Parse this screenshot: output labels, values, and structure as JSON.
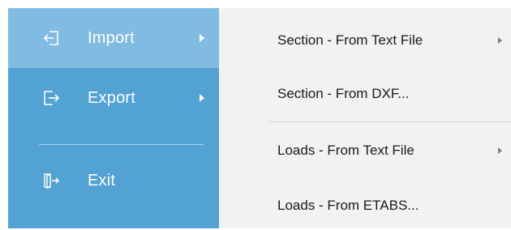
{
  "main_menu": {
    "items": [
      {
        "label": "Import",
        "icon": "import-icon",
        "has_submenu": true,
        "active": true
      },
      {
        "label": "Export",
        "icon": "export-icon",
        "has_submenu": true,
        "active": false
      },
      {
        "label": "Exit",
        "icon": "exit-icon",
        "has_submenu": false,
        "active": false
      }
    ]
  },
  "import_submenu": {
    "items": [
      {
        "label": "Section - From Text File",
        "has_submenu": true
      },
      {
        "label": "Section - From DXF...",
        "has_submenu": false
      },
      {
        "label": "Loads - From Text File",
        "has_submenu": true
      },
      {
        "label": "Loads - From ETABS...",
        "has_submenu": false
      }
    ]
  },
  "colors": {
    "menu_blue": "#52a2d4",
    "menu_blue_active": "#80bbe1",
    "submenu_bg": "#f2f2f2",
    "text_dark": "#1a1a1a"
  }
}
